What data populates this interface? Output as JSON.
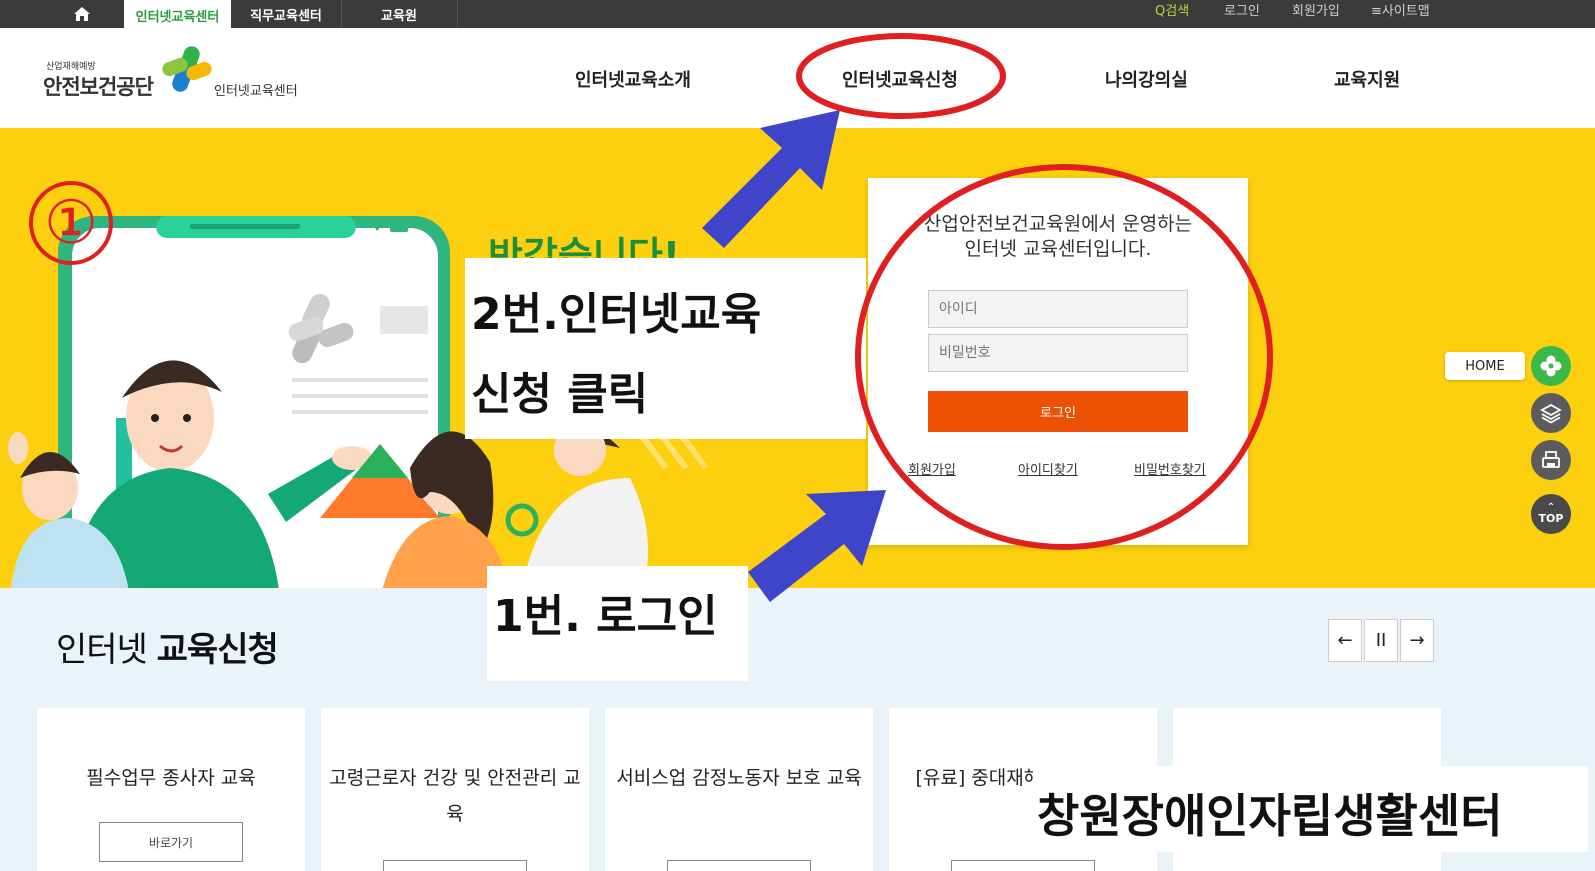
{
  "topbar": {
    "tabs": [
      "인터넷교육센터",
      "직무교육센터",
      "교육원"
    ],
    "utility": [
      "Q검색",
      "로그인",
      "회원가입",
      "≡사이트맵"
    ]
  },
  "logo": {
    "small": "산업재해예방",
    "main": "안전보건공단",
    "sub": "인터넷교육센터"
  },
  "gnb": [
    "인터넷교육소개",
    "인터넷교육신청",
    "나의강의실",
    "교육지원"
  ],
  "hero": {
    "title_partial": "반갑습니다!"
  },
  "login": {
    "intro_line1": "산업안전보건교육원에서 운영하는",
    "intro_line2": "인터넷 교육센터입니다.",
    "id_placeholder": "아이디",
    "pw_placeholder": "비밀번호",
    "login_button": "로그인",
    "links": [
      "회원가입",
      "아이디찾기",
      "비밀번호찾기"
    ]
  },
  "quick_menu": {
    "home_label": "HOME",
    "top_label": "TOP"
  },
  "section": {
    "title_light": "인터넷 ",
    "title_bold": "교육신청",
    "controls": [
      "←",
      "II",
      "→"
    ],
    "cards": [
      {
        "title": "필수업무 종사자 교육",
        "button": "바로가기"
      },
      {
        "title": "고령근로자 건강 및 안전관리 교육",
        "button": ""
      },
      {
        "title": "서비스업 감정노동자 보호 교육",
        "button": ""
      },
      {
        "title": "[유료] 중대재해 ... 임자 ...",
        "button": ""
      },
      {
        "title": "",
        "button": ""
      }
    ]
  },
  "annotations": {
    "circled_number": "①",
    "step2_line1": "2번.인터넷교육",
    "step2_line2": "신청 클릭",
    "step1": "1번. 로그인",
    "watermark": "창원장애인자립생활센터"
  },
  "colors": {
    "topbar": "#3b3b3b",
    "hero_yellow": "#fccf0f",
    "login_orange": "#ec5106",
    "green": "#2a9d3a",
    "annotation_red": "#e02020",
    "arrow_blue": "#3f45c8",
    "section_bg": "#eaf3f8"
  }
}
